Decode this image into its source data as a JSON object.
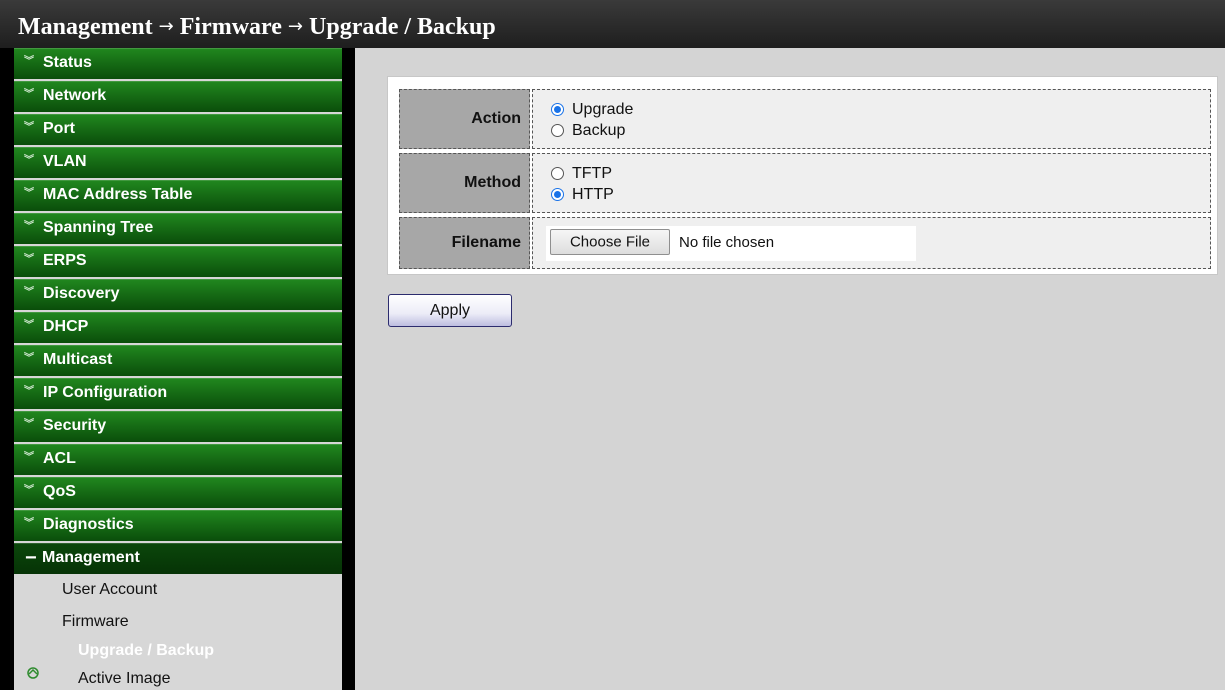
{
  "title": {
    "crumb1": "Management",
    "crumb2": "Firmware",
    "crumb3": "Upgrade / Backup",
    "separator": "→"
  },
  "sidebar": {
    "items": [
      {
        "label": "Status"
      },
      {
        "label": "Network"
      },
      {
        "label": "Port"
      },
      {
        "label": "VLAN"
      },
      {
        "label": "MAC Address Table"
      },
      {
        "label": "Spanning Tree"
      },
      {
        "label": "ERPS"
      },
      {
        "label": "Discovery"
      },
      {
        "label": "DHCP"
      },
      {
        "label": "Multicast"
      },
      {
        "label": "IP Configuration"
      },
      {
        "label": "Security"
      },
      {
        "label": "ACL"
      },
      {
        "label": "QoS"
      },
      {
        "label": "Diagnostics"
      }
    ],
    "open_section": {
      "label": "Management",
      "collapse_symbol": "−"
    },
    "sub_items": {
      "user_account": "User Account",
      "firmware": "Firmware",
      "upgrade_backup": "Upgrade / Backup",
      "active_image": "Active Image"
    },
    "expand_icon": "double-chevron-down-icon",
    "colors": {
      "nav_green": "#127012",
      "active_text": "#ffffff"
    }
  },
  "form": {
    "action": {
      "label": "Action",
      "options": [
        "Upgrade",
        "Backup"
      ],
      "selected": "Upgrade"
    },
    "method": {
      "label": "Method",
      "options": [
        "TFTP",
        "HTTP"
      ],
      "selected": "HTTP"
    },
    "filename": {
      "label": "Filename",
      "button": "Choose File",
      "status": "No file chosen"
    },
    "apply_label": "Apply"
  },
  "colors": {
    "radio_accent": "#1a73e8",
    "content_bg": "#d4d4d4",
    "title_bg": "#2b2b2b"
  }
}
